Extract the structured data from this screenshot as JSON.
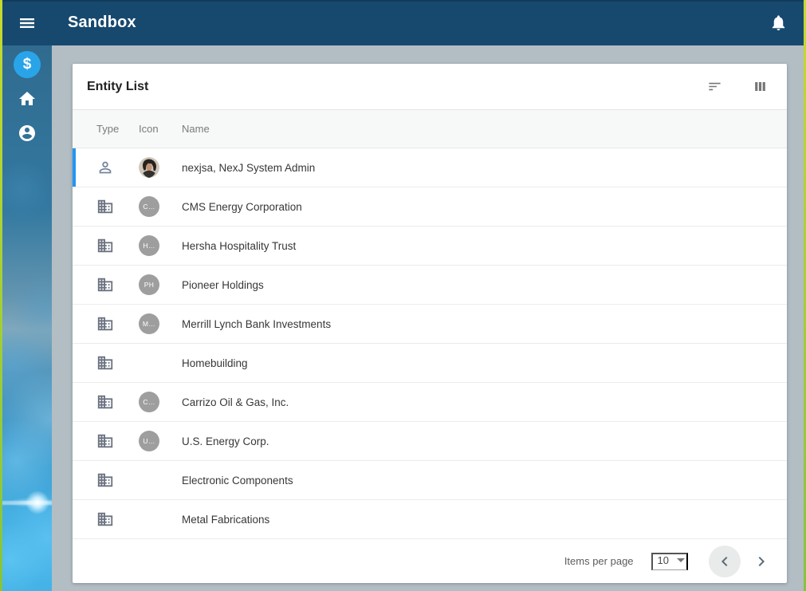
{
  "topbar": {
    "title": "Sandbox"
  },
  "sidebar": {
    "items": [
      {
        "id": "finance",
        "icon": "dollar-icon",
        "active": true
      },
      {
        "id": "home",
        "icon": "home-icon",
        "active": false
      },
      {
        "id": "profile",
        "icon": "person-circle-icon",
        "active": false
      }
    ]
  },
  "entity_list": {
    "title": "Entity List",
    "columns": [
      "Type",
      "Icon",
      "Name"
    ],
    "rows": [
      {
        "type": "person",
        "avatar": "photo",
        "initials": "",
        "name": "nexjsa, NexJ System Admin",
        "selected": true
      },
      {
        "type": "company",
        "avatar": "",
        "initials": "C…",
        "name": "CMS Energy Corporation",
        "selected": false
      },
      {
        "type": "company",
        "avatar": "",
        "initials": "H…",
        "name": "Hersha Hospitality Trust",
        "selected": false
      },
      {
        "type": "company",
        "avatar": "",
        "initials": "PH",
        "name": "Pioneer Holdings",
        "selected": false
      },
      {
        "type": "company",
        "avatar": "",
        "initials": "M…",
        "name": "Merrill Lynch Bank Investments",
        "selected": false
      },
      {
        "type": "company",
        "avatar": "",
        "initials": "",
        "name": "Homebuilding",
        "selected": false
      },
      {
        "type": "company",
        "avatar": "",
        "initials": "C…",
        "name": "Carrizo Oil & Gas, Inc.",
        "selected": false
      },
      {
        "type": "company",
        "avatar": "",
        "initials": "U…",
        "name": "U.S. Energy Corp.",
        "selected": false
      },
      {
        "type": "company",
        "avatar": "",
        "initials": "",
        "name": "Electronic Components",
        "selected": false
      },
      {
        "type": "company",
        "avatar": "",
        "initials": "",
        "name": "Metal Fabrications",
        "selected": false
      }
    ],
    "pagination": {
      "items_per_page_label": "Items per page",
      "page_size": "10"
    }
  },
  "colors": {
    "topbar": "#17496f",
    "selection_blue": "#2196f3",
    "active_item_blue": "#29a4e9",
    "content_bg": "#b3bdc4",
    "edge_green": "#a9ce38",
    "avatar_gray": "#9e9e9e"
  }
}
